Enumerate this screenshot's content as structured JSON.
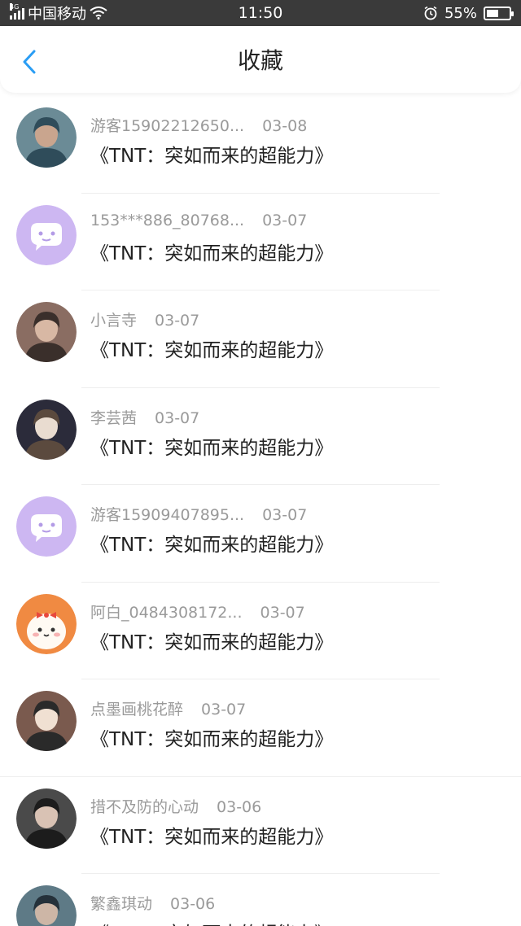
{
  "status_bar": {
    "network": "4G",
    "carrier": "中国移动",
    "time": "11:50",
    "battery_percent": "55%",
    "battery_level": 0.55,
    "icons": [
      "signal-icon",
      "wifi-icon",
      "alarm-icon",
      "battery-icon"
    ]
  },
  "header": {
    "title": "收藏",
    "back_icon": "chevron-left-icon",
    "accent_color": "#2a9df4"
  },
  "items": [
    {
      "name": "游客15902212650...",
      "date": "03-08",
      "title": "《TNT：突如而来的超能力》",
      "avatar": "photo"
    },
    {
      "name": "153***886_80768...",
      "date": "03-07",
      "title": "《TNT：突如而来的超能力》",
      "avatar": "default-chat"
    },
    {
      "name": "小言寺",
      "date": "03-07",
      "title": "《TNT：突如而来的超能力》",
      "avatar": "photo"
    },
    {
      "name": "李芸茜",
      "date": "03-07",
      "title": "《TNT：突如而来的超能力》",
      "avatar": "photo"
    },
    {
      "name": "游客15909407895...",
      "date": "03-07",
      "title": "《TNT：突如而来的超能力》",
      "avatar": "default-chat"
    },
    {
      "name": "阿白_0484308172...",
      "date": "03-07",
      "title": "《TNT：突如而来的超能力》",
      "avatar": "cartoon"
    },
    {
      "name": "点墨画桃花醉",
      "date": "03-07",
      "title": "《TNT：突如而来的超能力》",
      "avatar": "photo"
    },
    {
      "name": "措不及防的心动",
      "date": "03-06",
      "title": "《TNT：突如而来的超能力》",
      "avatar": "photo"
    },
    {
      "name": "繁鑫琪动",
      "date": "03-06",
      "title": "《TNT：突如而来的超能力》",
      "avatar": "photo"
    }
  ]
}
